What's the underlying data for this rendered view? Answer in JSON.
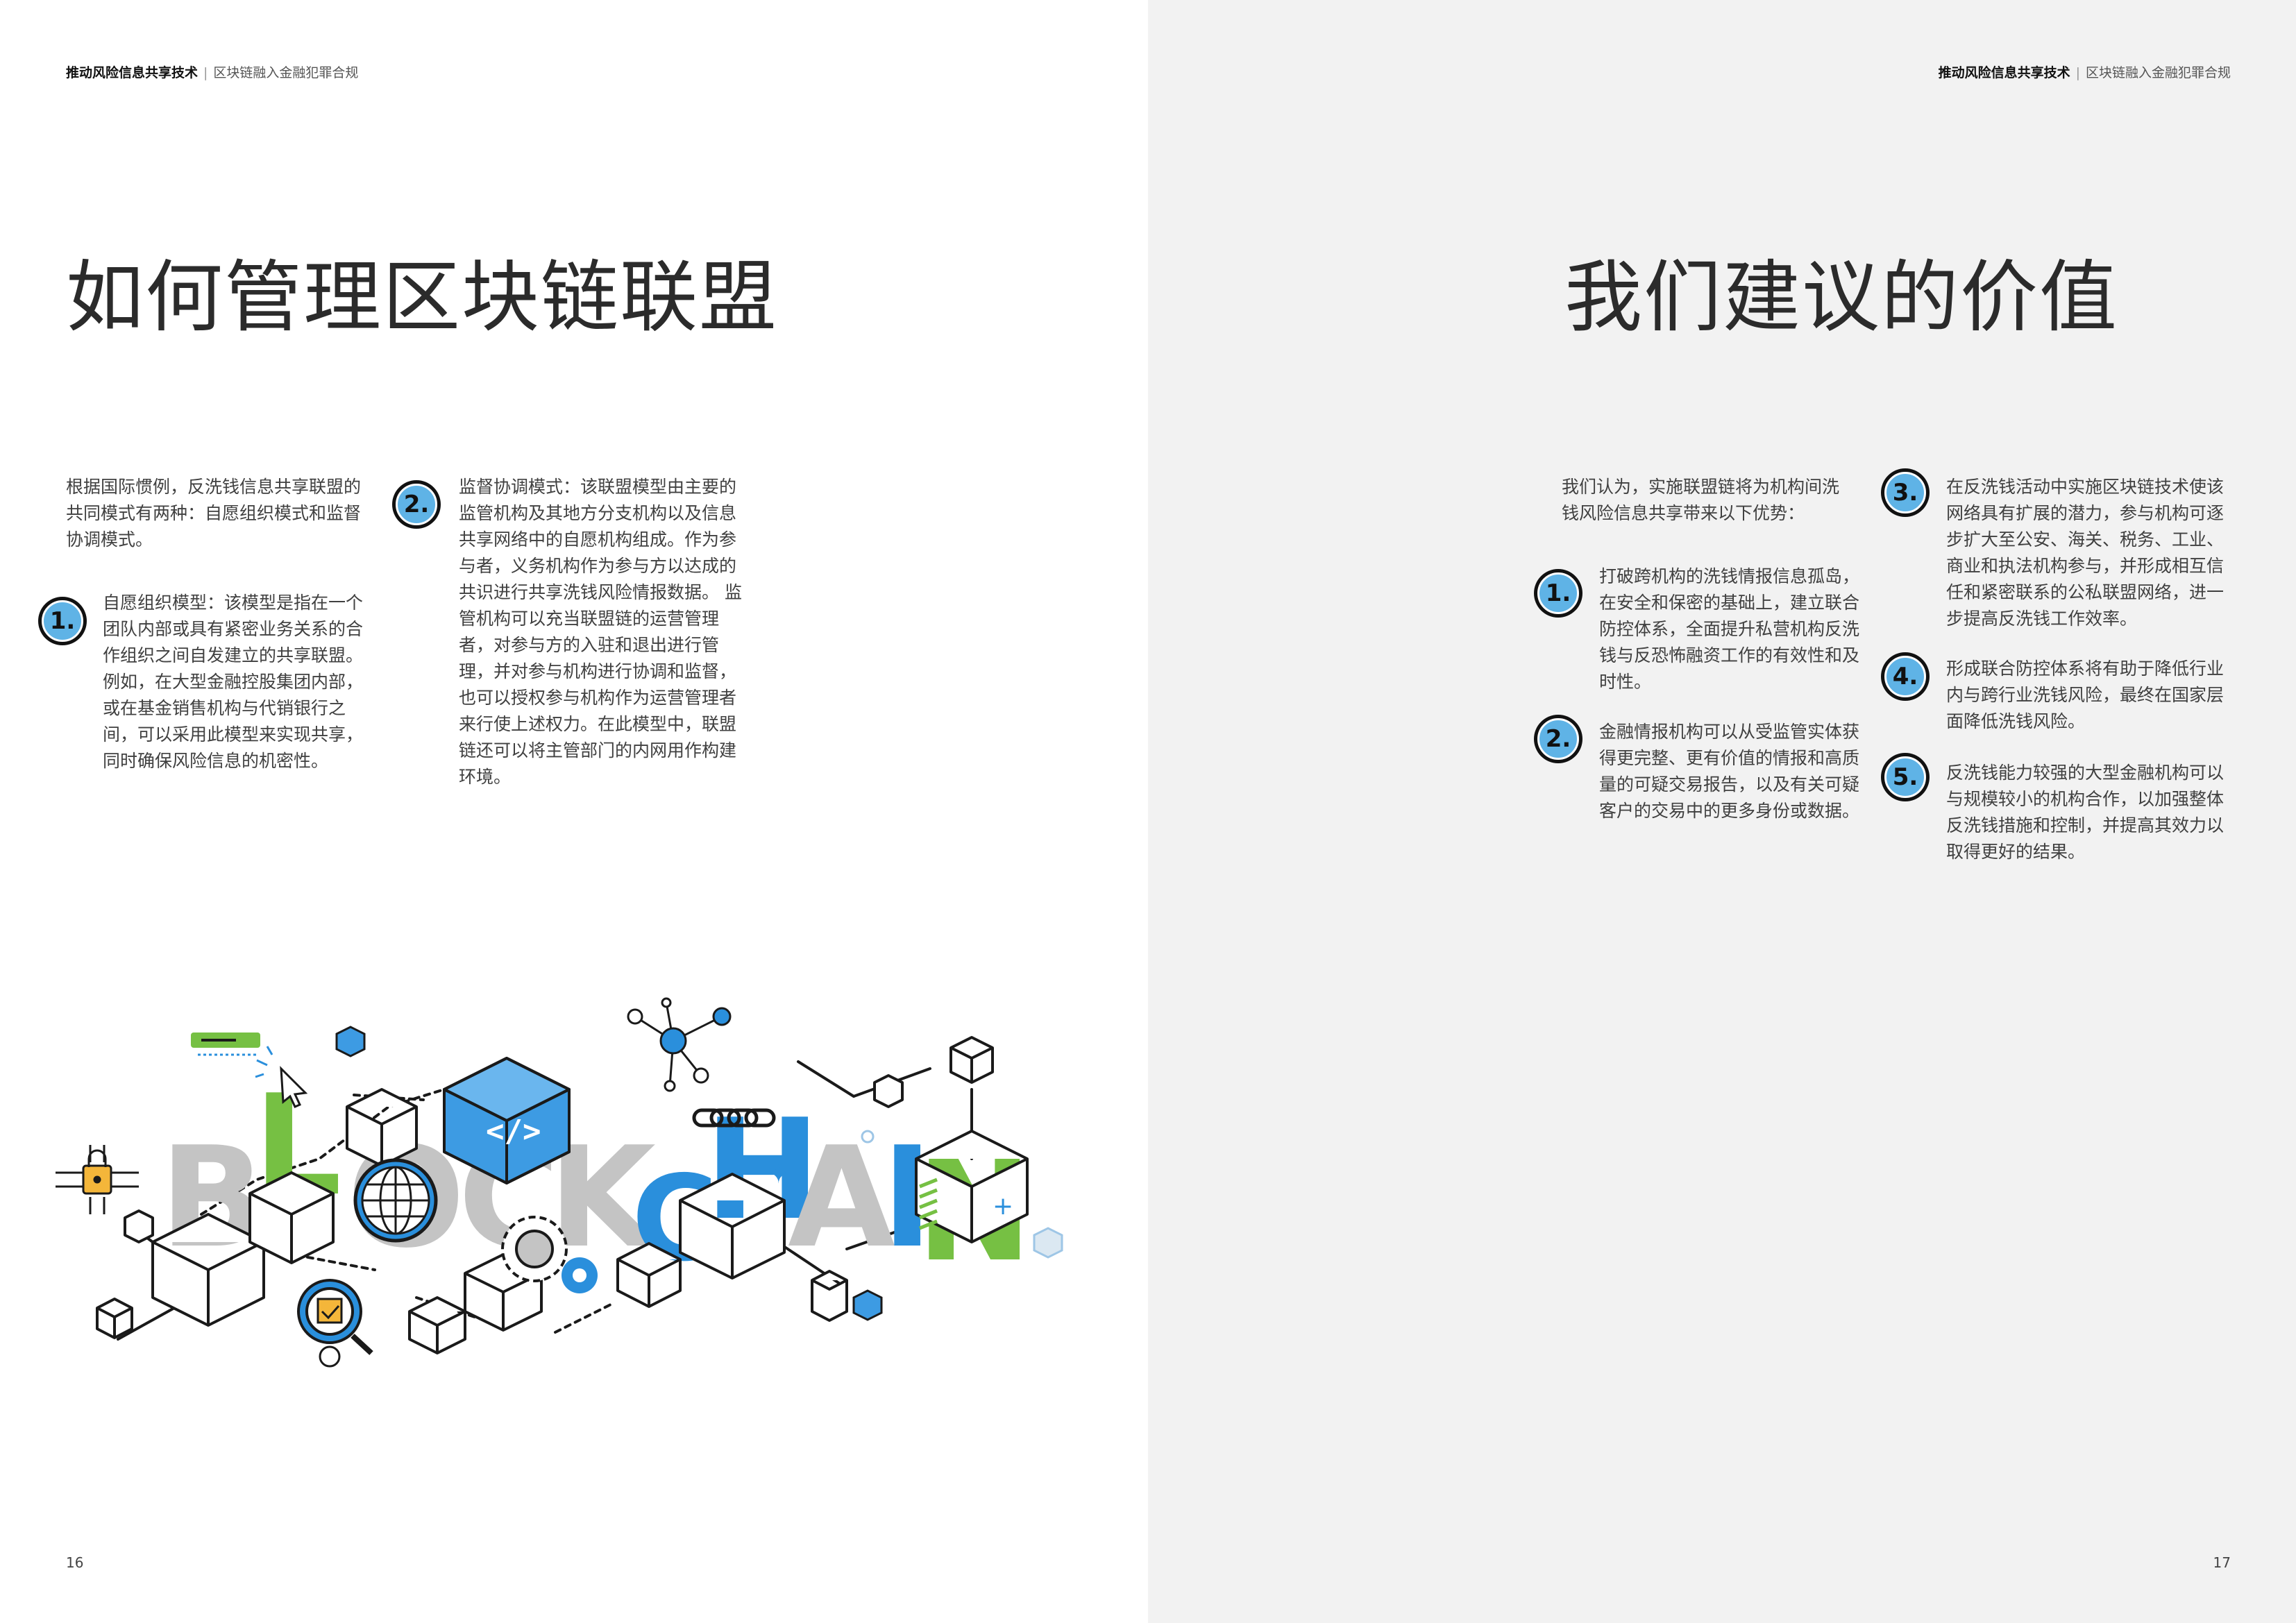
{
  "header": {
    "bold": "推动风险信息共享技术",
    "sep": "|",
    "rest": "区块链融入金融犯罪合规"
  },
  "left": {
    "title": "如何管理区块链联盟",
    "intro": "根据国际惯例，反洗钱信息共享联盟的共同模式有两种：自愿组织模式和监督协调模式。",
    "items": [
      {
        "num": "1.",
        "text": "自愿组织模型：该模型是指在一个团队内部或具有紧密业务关系的合作组织之间自发建立的共享联盟。例如，在大型金融控股集团内部，或在基金销售机构与代销银行之间，可以采用此模型来实现共享，同时确保风险信息的机密性。"
      },
      {
        "num": "2.",
        "text": "监督协调模式：该联盟模型由主要的监管机构及其地方分支机构以及信息共享网络中的自愿机构组成。作为参与者，义务机构作为参与方以达成的共识进行共享洗钱风险情报数据。 监管机构可以充当联盟链的运营管理者，对参与方的入驻和退出进行管理，并对参与机构进行协调和监督，也可以授权参与机构作为运营管理者来行使上述权力。在此模型中，联盟链还可以将主管部门的内网用作构建环境。"
      }
    ],
    "page_number": "16",
    "illustration": {
      "word": [
        "B",
        "L",
        "O",
        "C",
        "K",
        "C",
        "H",
        "A",
        "I",
        "N"
      ],
      "colors": {
        "gray": "#c4c4c4",
        "blue": "#2a8fdc",
        "green": "#76c043",
        "line": "#1a1a1a",
        "cube_blue": "#3d9be3",
        "gold": "#f4b63a"
      },
      "icons": [
        "lock-circuit-icon",
        "globe-icon",
        "gear-icon",
        "chain-icon",
        "network-node-icon",
        "cursor-icon",
        "code-cube-icon",
        "magnifier-check-icon",
        "message-bar-icon"
      ]
    }
  },
  "right": {
    "title": "我们建议的价值",
    "intro": "我们认为，实施联盟链将为机构间洗钱风险信息共享带来以下优势：",
    "items": [
      {
        "num": "1.",
        "text": "打破跨机构的洗钱情报信息孤岛，在安全和保密的基础上，建立联合防控体系，全面提升私营机构反洗钱与反恐怖融资工作的有效性和及时性。"
      },
      {
        "num": "2.",
        "text": "金融情报机构可以从受监管实体获得更完整、更有价值的情报和高质量的可疑交易报告，以及有关可疑客户的交易中的更多身份或数据。"
      },
      {
        "num": "3.",
        "text": "在反洗钱活动中实施区块链技术使该网络具有扩展的潜力，参与机构可逐步扩大至公安、海关、税务、工业、商业和执法机构参与，并形成相互信任和紧密联系的公私联盟网络，进一步提高反洗钱工作效率。"
      },
      {
        "num": "4.",
        "text": "形成联合防控体系将有助于降低行业内与跨行业洗钱风险，最终在国家层面降低洗钱风险。"
      },
      {
        "num": "5.",
        "text": "反洗钱能力较强的大型金融机构可以与规模较小的机构合作，以加强整体反洗钱措施和控制，并提高其效力以取得更好的结果。"
      }
    ],
    "page_number": "17"
  }
}
